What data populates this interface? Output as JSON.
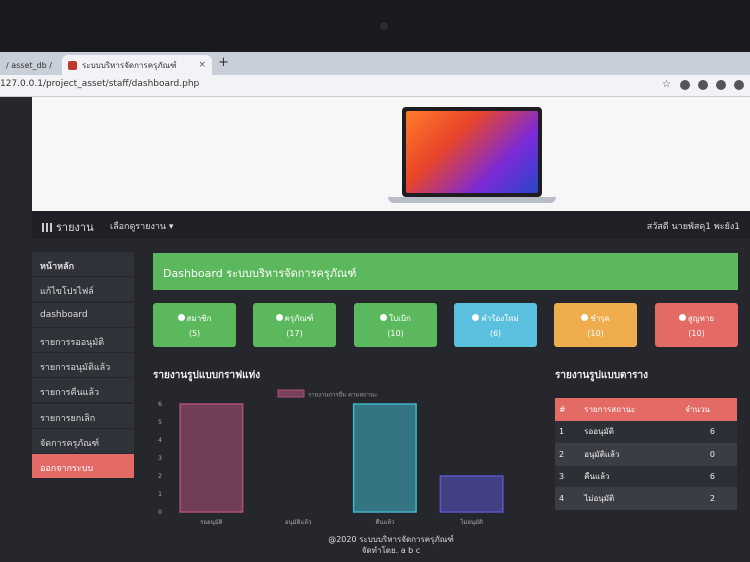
{
  "browser": {
    "tabs": [
      {
        "label": "/ asset_db /"
      },
      {
        "label": "ระบบบริหารจัดการครุภัณฑ์"
      }
    ],
    "new_tab": "+",
    "close": "×",
    "url": "127.0.0.1/project_asset/staff/dashboard.php"
  },
  "navbar": {
    "brand": "รายงาน",
    "dropdown": "เลือกดูรายงาน ▾",
    "greeting": "สวัสดี นายพัสดุ1 พะยัง1"
  },
  "sidebar": {
    "items": [
      {
        "label": "หน้าหลัก"
      },
      {
        "label": "แก้ไขโปรไฟล์"
      },
      {
        "label": "dashboard"
      },
      {
        "label": "รายการรออนุมัติ"
      },
      {
        "label": "รายการอนุมัติแล้ว"
      },
      {
        "label": "รายการคืนแล้ว"
      },
      {
        "label": "รายการยกเลิก"
      },
      {
        "label": "จัดการครุภัณฑ์"
      },
      {
        "label": "ออกจากระบบ"
      }
    ]
  },
  "main": {
    "title": "Dashboard ระบบบริหารจัดการครุภัณฑ์",
    "cards": [
      {
        "label": "สมาชิก",
        "count": "(5)",
        "color": "#5cb85c"
      },
      {
        "label": "ครุภัณฑ์",
        "count": "(17)",
        "color": "#5cb85c"
      },
      {
        "label": "ใบเบิก",
        "count": "(10)",
        "color": "#5cb85c"
      },
      {
        "label": "คำร้องใหม่",
        "count": "(6)",
        "color": "#5bc0de"
      },
      {
        "label": "ชำรุด",
        "count": "(10)",
        "color": "#f0ad4e"
      },
      {
        "label": "สูญหาย",
        "count": "(10)",
        "color": "#e46a66"
      }
    ],
    "chart_title": "รายงานรูปแบบกราฟแท่ง",
    "table_title": "รายงานรูปแบบตาราง",
    "table": {
      "headers": [
        "#",
        "รายการสถานะ",
        "จำนวน"
      ],
      "rows": [
        [
          "1",
          "รออนุมัติ",
          "6"
        ],
        [
          "2",
          "อนุมัติแล้ว",
          "0"
        ],
        [
          "3",
          "คืนแล้ว",
          "6"
        ],
        [
          "4",
          "ไม่อนุมัติ",
          "2"
        ]
      ]
    }
  },
  "chart_data": {
    "type": "bar",
    "categories": [
      "รออนุมัติ",
      "อนุมัติแล้ว",
      "คืนแล้ว",
      "ไม่อนุมัติ"
    ],
    "series": [
      {
        "name": "รายงานการยืม ตามสถานะ",
        "values": [
          6,
          0,
          6,
          2
        ]
      }
    ],
    "colors": [
      "#b0517a",
      "#6b4d8f",
      "#3fb6c9",
      "#5a56c9"
    ],
    "ylim": [
      0,
      6
    ],
    "yticks": [
      0,
      1,
      2,
      3,
      4,
      5,
      6
    ]
  },
  "footer": {
    "line1": "@2020 ระบบบริหารจัดการครุภัณฑ์",
    "line2": "จัดทำโดย. a b c"
  }
}
